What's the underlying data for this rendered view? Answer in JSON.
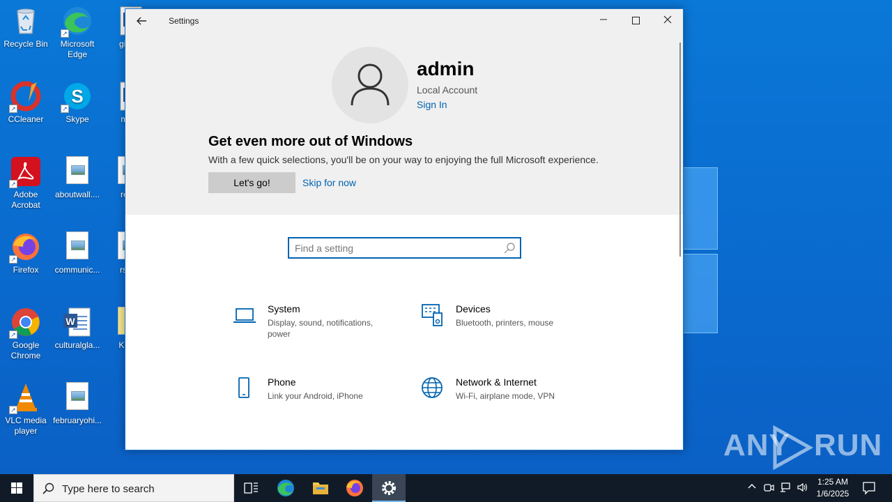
{
  "desktop": {
    "icons": [
      {
        "label": "Recycle Bin",
        "icon": "recycle-bin-icon"
      },
      {
        "label": "Microsoft Edge",
        "icon": "edge-icon"
      },
      {
        "label": "gives",
        "icon": "word-doc-icon"
      },
      {
        "label": "CCleaner",
        "icon": "ccleaner-icon"
      },
      {
        "label": "Skype",
        "icon": "skype-icon"
      },
      {
        "label": "men",
        "icon": "word-doc-icon"
      },
      {
        "label": "Adobe Acrobat",
        "icon": "acrobat-icon"
      },
      {
        "label": "aboutwall....",
        "icon": "image-file-icon"
      },
      {
        "label": "repo",
        "icon": "image-file-icon"
      },
      {
        "label": "Firefox",
        "icon": "firefox-icon"
      },
      {
        "label": "communic...",
        "icon": "image-file-icon"
      },
      {
        "label": "rssth",
        "icon": "image-file-icon"
      },
      {
        "label": "Google Chrome",
        "icon": "chrome-icon"
      },
      {
        "label": "culturalgla...",
        "icon": "word-doc-icon"
      },
      {
        "label": "KeyU",
        "icon": "file-icon"
      },
      {
        "label": "VLC media player",
        "icon": "vlc-icon"
      },
      {
        "label": "februaryohi...",
        "icon": "image-file-icon"
      }
    ]
  },
  "window": {
    "title": "Settings",
    "back_icon": "back-arrow-icon",
    "min_icon": "minimize-icon",
    "max_icon": "maximize-icon",
    "close_icon": "close-icon"
  },
  "account": {
    "name": "admin",
    "type": "Local Account",
    "sign_in": "Sign In"
  },
  "promo": {
    "title": "Get even more out of Windows",
    "text": "With a few quick selections, you'll be on your way to enjoying the full Microsoft experience.",
    "primary": "Let's go!",
    "secondary": "Skip for now"
  },
  "search": {
    "placeholder": "Find a setting"
  },
  "categories": [
    {
      "name": "System",
      "desc": "Display, sound, notifications, power",
      "icon": "laptop-icon"
    },
    {
      "name": "Devices",
      "desc": "Bluetooth, printers, mouse",
      "icon": "devices-icon"
    },
    {
      "name": "Phone",
      "desc": "Link your Android, iPhone",
      "icon": "phone-icon"
    },
    {
      "name": "Network & Internet",
      "desc": "Wi-Fi, airplane mode, VPN",
      "icon": "globe-icon"
    }
  ],
  "taskbar": {
    "search_text": "Type here to search",
    "time": "1:25 AM",
    "date": "1/6/2025"
  },
  "watermark": {
    "left": "ANY",
    "right": "RUN"
  },
  "colors": {
    "accent": "#0063b1",
    "desktop": "#0a78d7",
    "taskbar": "#111b28"
  }
}
